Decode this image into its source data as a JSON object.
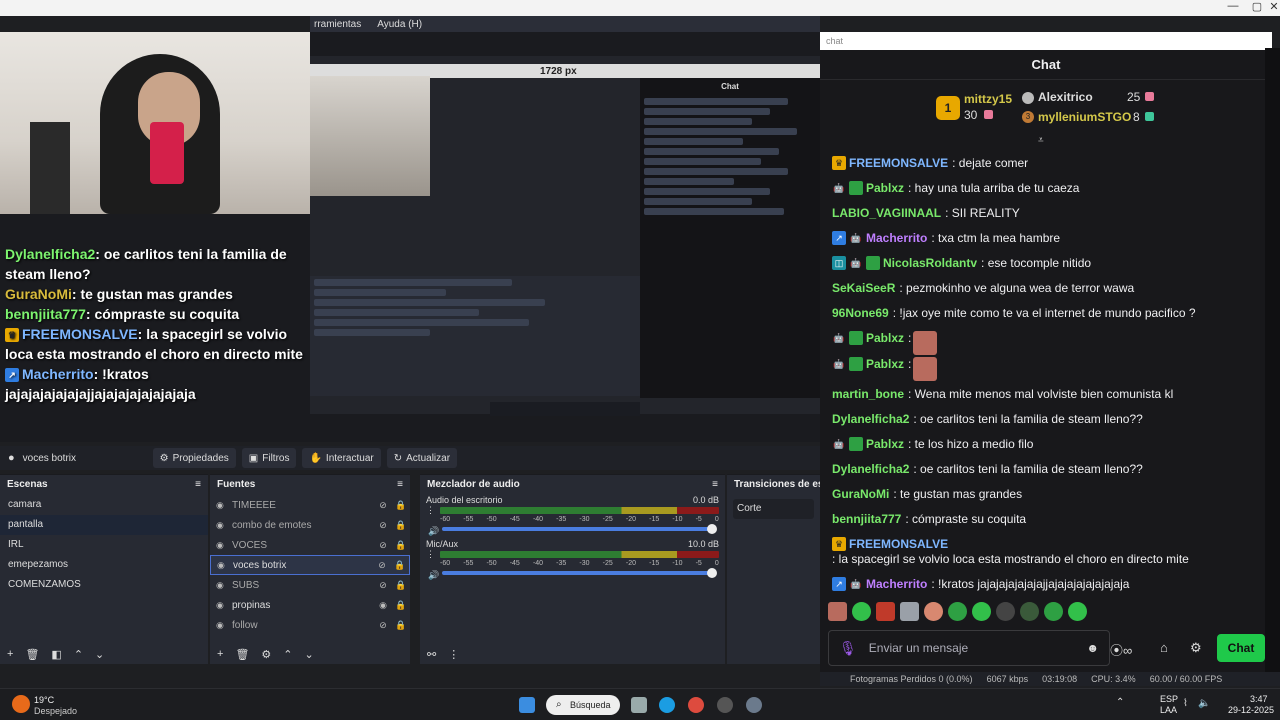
{
  "window": {
    "menu": [
      "rramientas",
      "Ayuda (H)"
    ],
    "controls": [
      "—",
      "▢",
      "✕"
    ]
  },
  "nested": {
    "px_label": "1728 px",
    "chat_title": "Chat",
    "rows_count_label": ""
  },
  "overlay_chat": [
    {
      "user": "Dylanelficha2",
      "color": "#7df46f",
      "text": ": oe carlitos teni la familia de steam lleno?",
      "badge": ""
    },
    {
      "user": "GuraNoMi",
      "color": "#d8bb3c",
      "text": ": te gustan mas grandes",
      "badge": ""
    },
    {
      "user": "bennjiita777",
      "color": "#7df46f",
      "text": ": cómpraste su coquita",
      "badge": ""
    },
    {
      "user": "FREEMONSALVE",
      "color": "#7fb7ff",
      "text": ": la spacegirl se volvio loca esta mostrando el choro en directo mite",
      "badge": "crown"
    },
    {
      "user": "Macherrito",
      "color": "#7fb7ff",
      "text": ": !kratos jajajajajajajajjajajajajajajajaja",
      "badge": "prime"
    }
  ],
  "source_toolbar": {
    "source_name": "voces botrix",
    "buttons": [
      "Propiedades",
      "Filtros",
      "Interactuar",
      "Actualizar"
    ]
  },
  "scenes": {
    "title": "Escenas",
    "items": [
      "camara",
      "pantalla",
      "IRL",
      "emepezamos",
      "COMENZAMOS"
    ],
    "selected": 1
  },
  "sources": {
    "title": "Fuentes",
    "items": [
      {
        "name": "TIMEEEE",
        "visible": false
      },
      {
        "name": "combo de emotes",
        "visible": false
      },
      {
        "name": "VOCES",
        "visible": false
      },
      {
        "name": "voces botrix",
        "visible": false
      },
      {
        "name": "SUBS",
        "visible": false
      },
      {
        "name": "propinas",
        "visible": true
      },
      {
        "name": "follow",
        "visible": false
      }
    ],
    "selected": 3
  },
  "mixer": {
    "title": "Mezclador de audio",
    "channels": [
      {
        "name": "Audio del escritorio",
        "db": "0.0 dB"
      },
      {
        "name": "Mic/Aux",
        "db": "10.0 dB"
      }
    ],
    "ticks": [
      "-60",
      "-55",
      "-50",
      "-45",
      "-40",
      "-35",
      "-30",
      "-25",
      "-20",
      "-15",
      "-10",
      "-5",
      "0"
    ]
  },
  "transitions": {
    "title": "Transiciones de esce",
    "value": "Corte"
  },
  "chat": {
    "url": "chat",
    "title": "Chat",
    "podium": {
      "first": {
        "rank": "1",
        "user": "mittzy15",
        "count": "30"
      },
      "second": {
        "user": "Alexitrico",
        "count": "25"
      },
      "third": {
        "rank": "3",
        "user": "mylleniumSTGO",
        "count": "8"
      }
    },
    "messages": [
      {
        "user": "FREEMONSALVE",
        "color": "#7fb7ff",
        "text": ": dejate comer",
        "badges": [
          "crown"
        ]
      },
      {
        "user": "Pablxz",
        "color": "#79e96b",
        "text": ": hay una tula arriba de tu caeza",
        "badges": [
          "robot",
          "green"
        ]
      },
      {
        "user": "LABIO_VAGIINAAL",
        "color": "#79e96b",
        "text": ": SII REALITY",
        "badges": []
      },
      {
        "user": "Macherrito",
        "color": "#bf7fff",
        "text": ": txa ctm la mea hambre",
        "badges": [
          "prime",
          "robot"
        ]
      },
      {
        "user": "NicolasRoldantv",
        "color": "#79e96b",
        "text": ": ese tocomple nitido",
        "badges": [
          "sub",
          "robot",
          "green"
        ]
      },
      {
        "user": "SeKaiSeeR",
        "color": "#79e96b",
        "text": ": pezmokinho ve alguna wea de terror wawa",
        "badges": []
      },
      {
        "user": "96None69",
        "color": "#79e96b",
        "text": ": !jax oye mite como te va el internet de mundo pacifico ?",
        "badges": []
      },
      {
        "user": "Pablxz",
        "color": "#79e96b",
        "text": ":",
        "badges": [
          "robot",
          "green"
        ],
        "emote": true
      },
      {
        "user": "Pablxz",
        "color": "#79e96b",
        "text": ":",
        "badges": [
          "robot",
          "green"
        ],
        "emote": true
      },
      {
        "user": "martin_bone",
        "color": "#79e96b",
        "text": ": Wena mite menos mal volviste bien comunista kl",
        "badges": []
      },
      {
        "user": "Dylanelficha2",
        "color": "#79e96b",
        "text": ": oe carlitos teni la familia de steam lleno??",
        "badges": []
      },
      {
        "user": "Pablxz",
        "color": "#79e96b",
        "text": ": te los hizo a medio filo",
        "badges": [
          "robot",
          "green"
        ]
      },
      {
        "user": "Dylanelficha2",
        "color": "#79e96b",
        "text": ": oe carlitos teni la familia de steam lleno??",
        "badges": []
      },
      {
        "user": "GuraNoMi",
        "color": "#79e96b",
        "text": ": te gustan mas grandes",
        "badges": []
      },
      {
        "user": "bennjiita777",
        "color": "#79e96b",
        "text": ": cómpraste su coquita",
        "badges": []
      },
      {
        "user": "FREEMONSALVE",
        "color": "#7fb7ff",
        "text": ": la spacegirl se volvio loca esta mostrando el choro en directo mite",
        "badges": [
          "crown"
        ]
      },
      {
        "user": "Macherrito",
        "color": "#bf7fff",
        "text": ": !kratos jajajajajajajajjajajajajajajajaja",
        "badges": [
          "prime",
          "robot"
        ]
      }
    ],
    "input_placeholder": "Enviar un mensaje",
    "send_label": "Chat"
  },
  "status": {
    "dropped": "Fotogramas Perdidos 0 (0.0%)",
    "kbps": "6067 kbps",
    "time": "03:19:08",
    "cpu": "CPU: 3.4%",
    "fps": "60.00 / 60.00 FPS"
  },
  "taskbar": {
    "weather_temp": "19°C",
    "weather_desc": "Despejado",
    "search_label": "Búsqueda",
    "lang": "ESP",
    "lang2": "LAA",
    "time": "3:47",
    "date": "29-12-2025"
  },
  "colors": {
    "accent_green": "#1fc94a",
    "obs_select": "#4a6fd1"
  }
}
